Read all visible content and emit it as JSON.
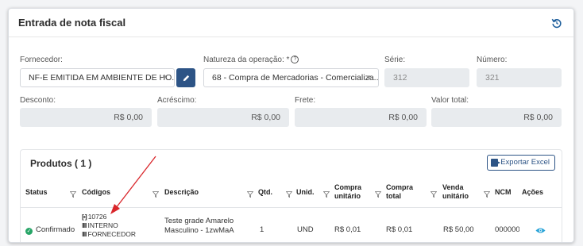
{
  "header": {
    "title": "Entrada de nota fiscal",
    "refresh_icon": "refresh-icon"
  },
  "form": {
    "fornecedor": {
      "label": "Fornecedor:",
      "value": "NF-E EMITIDA EM AMBIENTE DE HO..."
    },
    "natureza": {
      "label": "Natureza da operação: *",
      "value": "68 - Compra de Mercadorias - Comercializa..."
    },
    "serie": {
      "label": "Série:",
      "value": "312"
    },
    "numero": {
      "label": "Número:",
      "value": "321"
    },
    "desconto": {
      "label": "Desconto:",
      "value": "R$ 0,00"
    },
    "acrescimo": {
      "label": "Acréscimo:",
      "value": "R$ 0,00"
    },
    "frete": {
      "label": "Frete:",
      "value": "R$ 0,00"
    },
    "valor_total": {
      "label": "Valor total:",
      "value": "R$ 0,00"
    }
  },
  "products": {
    "title": "Produtos ( 1 )",
    "export_label": "Exportar Excel",
    "columns": {
      "status": "Status",
      "codigos": "Códigos",
      "descricao": "Descrição",
      "qtd": "Qtd.",
      "unid": "Unid.",
      "compra_unitario_1": "Compra",
      "compra_unitario_2": "unitário",
      "compra_total_1": "Compra",
      "compra_total_2": "total",
      "venda_unitario_1": "Venda",
      "venda_unitario_2": "unitário",
      "ncm": "NCM",
      "acoes": "Ações"
    },
    "rows": [
      {
        "status": "Confirmado",
        "code_main": "10726",
        "code_interno": "INTERNO",
        "code_fornecedor": "FORNECEDOR",
        "descricao_1": "Teste grade Amarelo",
        "descricao_2": "Masculino - 1zwMaA",
        "qtd": "1",
        "unid": "UND",
        "compra_unitario": "R$ 0,01",
        "compra_total": "R$ 0,01",
        "venda_unitario": "R$ 50,00",
        "ncm": "0000000"
      }
    ]
  },
  "colors": {
    "primary": "#2d5486",
    "success": "#27a567",
    "annotation": "#d9262b"
  }
}
